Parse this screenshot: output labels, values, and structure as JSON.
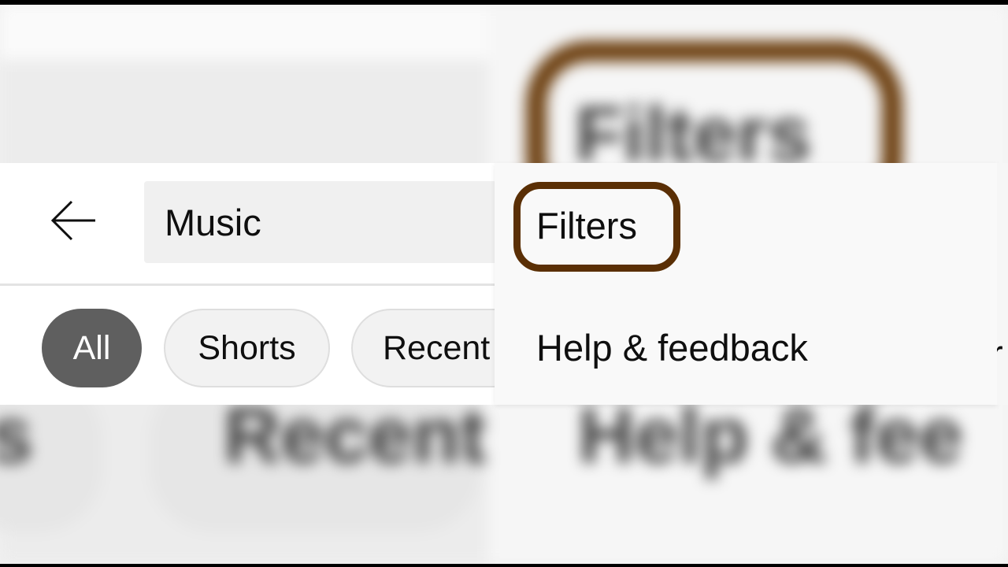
{
  "search": {
    "query": "Music"
  },
  "chips": [
    {
      "label": "All",
      "selected": true
    },
    {
      "label": "Shorts",
      "selected": false
    },
    {
      "label": "Recent",
      "selected": false
    }
  ],
  "menu": {
    "items": [
      {
        "label": "Filters",
        "highlighted": true
      },
      {
        "label": "Help & feedback",
        "highlighted": false
      }
    ]
  },
  "background": {
    "zoom_text_filters": "Filters",
    "zoom_text_recent": "Recent",
    "zoom_text_help": "Help & fee",
    "zoom_text_chip_fragment": "s"
  },
  "icons": {
    "back": "arrow-left-icon"
  },
  "colors": {
    "highlight_ring": "#5a2f05",
    "selected_chip": "#5f5f5f",
    "chip_background": "#f2f2f2"
  }
}
